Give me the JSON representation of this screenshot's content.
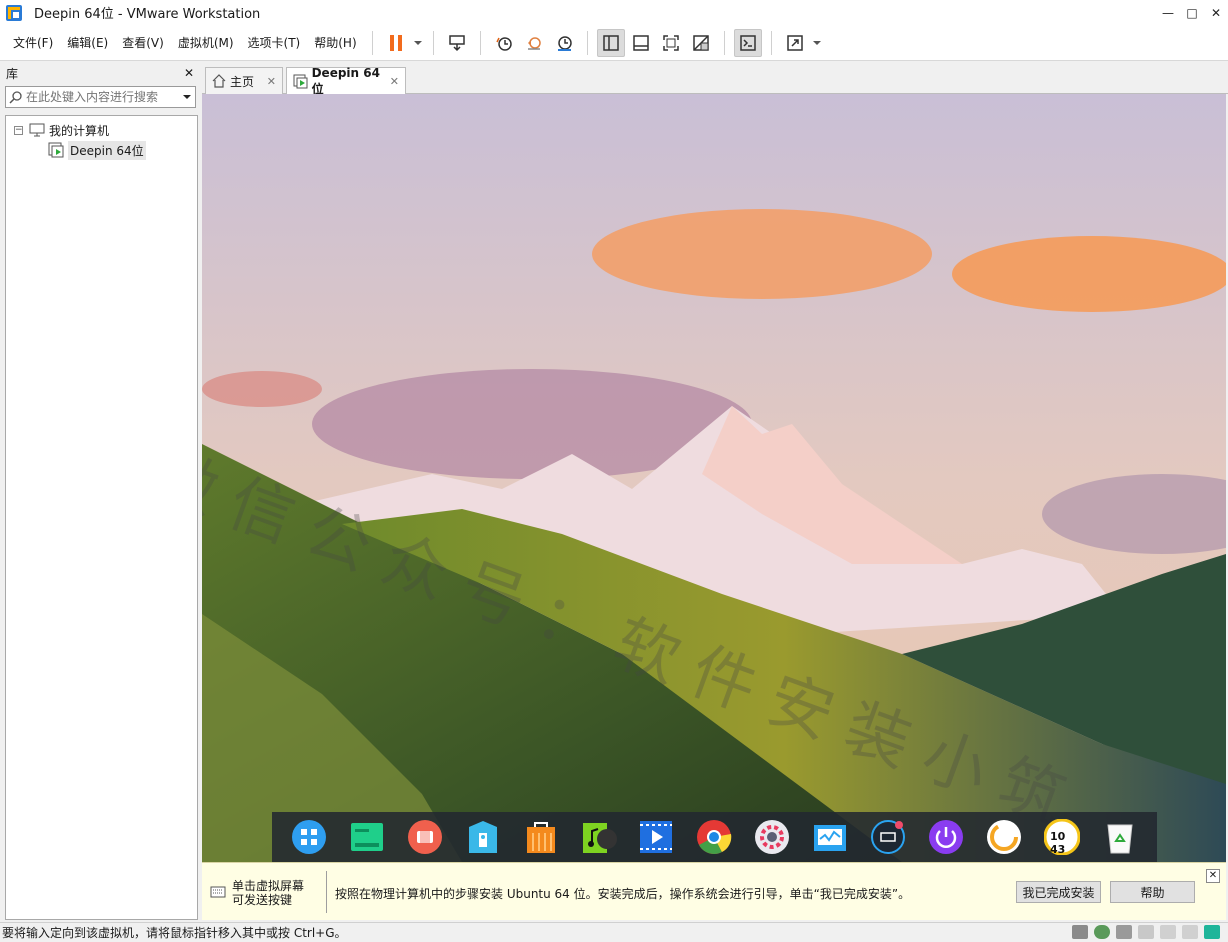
{
  "window": {
    "title": "Deepin 64位 - VMware Workstation",
    "minimize": "—",
    "maximize": "□",
    "close": "✕"
  },
  "menu": [
    "文件(F)",
    "编辑(E)",
    "查看(V)",
    "虚拟机(M)",
    "选项卡(T)",
    "帮助(H)"
  ],
  "toolbar": {
    "icons": [
      "pause-icon",
      "send-ctrl-alt-del-icon",
      "snapshot-icon",
      "revert-snapshot-icon",
      "snapshot-manager-icon",
      "show-library-icon",
      "thumbnail-bar-icon",
      "full-screen-icon",
      "unity-icon",
      "console-view-icon",
      "stretch-icon"
    ],
    "pause_color": "#f26b1d"
  },
  "library": {
    "title": "库",
    "close": "✕",
    "search_placeholder": "在此处键入内容进行搜索",
    "root": "我的计算机",
    "expander": "−",
    "vm": "Deepin 64位"
  },
  "tabs": [
    {
      "label": "主页",
      "close": "✕"
    },
    {
      "label": "Deepin 64位",
      "close": "✕"
    }
  ],
  "guest": {
    "watermark": "微信公众号：软件安装小筑",
    "dock_apps": [
      "launcher-icon",
      "file-manager-icon",
      "screen-recorder-icon",
      "app-store-icon",
      "store-bag-icon",
      "music-icon",
      "video-player-icon",
      "chrome-icon",
      "settings-icon",
      "system-monitor-icon",
      "onscreen-keyboard-icon",
      "power-icon",
      "datetime-icon",
      "clock-icon",
      "trash-icon"
    ],
    "clock_text": "10 43"
  },
  "infobar": {
    "hint_line1": "单击虚拟屏幕",
    "hint_line2": "可发送按键",
    "message": "按照在物理计算机中的步骤安装 Ubuntu 64 位。安装完成后，操作系统会进行引导，单击“我已完成安装”。",
    "done_button": "我已完成安装",
    "help_button": "帮助",
    "close": "✕"
  },
  "status": {
    "text": "要将输入定向到该虚拟机，请将鼠标指针移入其中或按 Ctrl+G。"
  }
}
